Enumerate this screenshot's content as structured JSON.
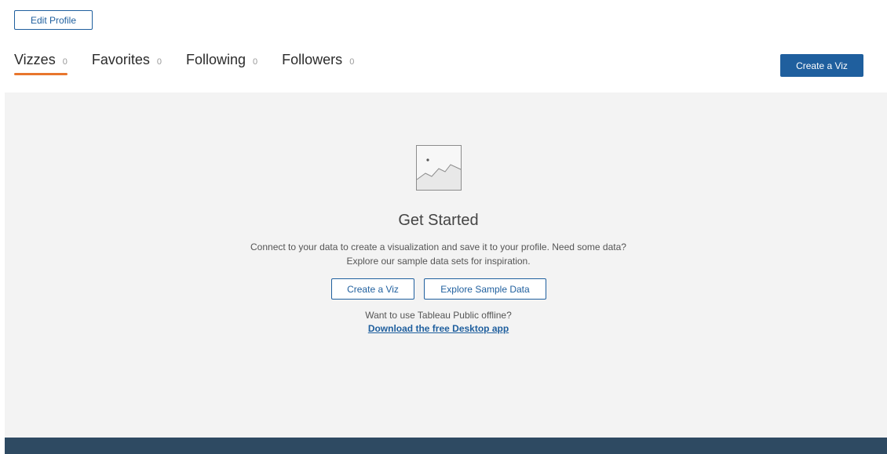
{
  "profile": {
    "edit_label": "Edit Profile"
  },
  "tabs": [
    {
      "label": "Vizzes",
      "count": "0",
      "active": true
    },
    {
      "label": "Favorites",
      "count": "0"
    },
    {
      "label": "Following",
      "count": "0"
    },
    {
      "label": "Followers",
      "count": "0"
    }
  ],
  "header": {
    "create_viz_label": "Create a Viz"
  },
  "empty_state": {
    "icon": "image-placeholder-icon",
    "title": "Get Started",
    "description_line1": "Connect to your data to create a visualization and save it to your profile. Need some data?",
    "description_line2": "Explore our sample data sets for inspiration.",
    "create_viz_label": "Create a Viz",
    "explore_label": "Explore Sample Data",
    "offline_text": "Want to use Tableau Public offline?",
    "download_link": "Download the free Desktop app"
  },
  "colors": {
    "accent_blue": "#1f5f9e",
    "active_tab_underline": "#e8762d",
    "panel_bg": "#f3f3f3",
    "footer_bg": "#2e4a62"
  }
}
